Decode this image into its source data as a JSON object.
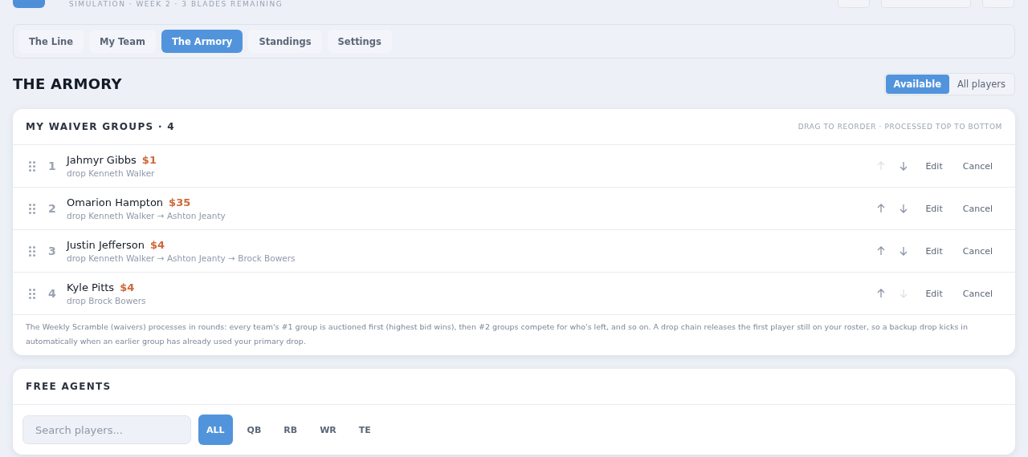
{
  "header": {
    "subtitle": "SIMULATION · WEEK 2 · 3 BLADES REMAINING"
  },
  "tabs": [
    {
      "label": "The Line",
      "selected": false
    },
    {
      "label": "My Team",
      "selected": false
    },
    {
      "label": "The Armory",
      "selected": true
    },
    {
      "label": "Standings",
      "selected": false
    },
    {
      "label": "Settings",
      "selected": false
    }
  ],
  "page_title": "THE ARMORY",
  "view_toggle": [
    {
      "label": "Available",
      "selected": true
    },
    {
      "label": "All players",
      "selected": false
    }
  ],
  "waiver_groups": {
    "title": "MY WAIVER GROUPS · 4",
    "hint": "DRAG TO REORDER · PROCESSED TOP TO BOTTOM",
    "rows": [
      {
        "rank": "1",
        "player": "Jahmyr Gibbs",
        "bid": "$1",
        "drops": "drop Kenneth Walker",
        "up_disabled": true,
        "down_disabled": false,
        "edit": "Edit",
        "cancel": "Cancel"
      },
      {
        "rank": "2",
        "player": "Omarion Hampton",
        "bid": "$35",
        "drops": "drop Kenneth Walker → Ashton Jeanty",
        "up_disabled": false,
        "down_disabled": false,
        "edit": "Edit",
        "cancel": "Cancel"
      },
      {
        "rank": "3",
        "player": "Justin Jefferson",
        "bid": "$4",
        "drops": "drop Kenneth Walker → Ashton Jeanty → Brock Bowers",
        "up_disabled": false,
        "down_disabled": false,
        "edit": "Edit",
        "cancel": "Cancel"
      },
      {
        "rank": "4",
        "player": "Kyle Pitts",
        "bid": "$4",
        "drops": "drop Brock Bowers",
        "up_disabled": false,
        "down_disabled": true,
        "edit": "Edit",
        "cancel": "Cancel"
      }
    ],
    "note": "The Weekly Scramble (waivers) processes in rounds: every team's #1 group is auctioned first (highest bid wins), then #2 groups compete for who's left, and so on. A drop chain releases the first player still on your roster, so a backup drop kicks in automatically when an earlier group has already used your primary drop."
  },
  "free_agents": {
    "title": "FREE AGENTS",
    "search": {
      "placeholder": "Search players..."
    },
    "positions": [
      {
        "label": "ALL",
        "selected": true
      },
      {
        "label": "QB",
        "selected": false
      },
      {
        "label": "RB",
        "selected": false
      },
      {
        "label": "WR",
        "selected": false
      },
      {
        "label": "TE",
        "selected": false
      }
    ]
  }
}
